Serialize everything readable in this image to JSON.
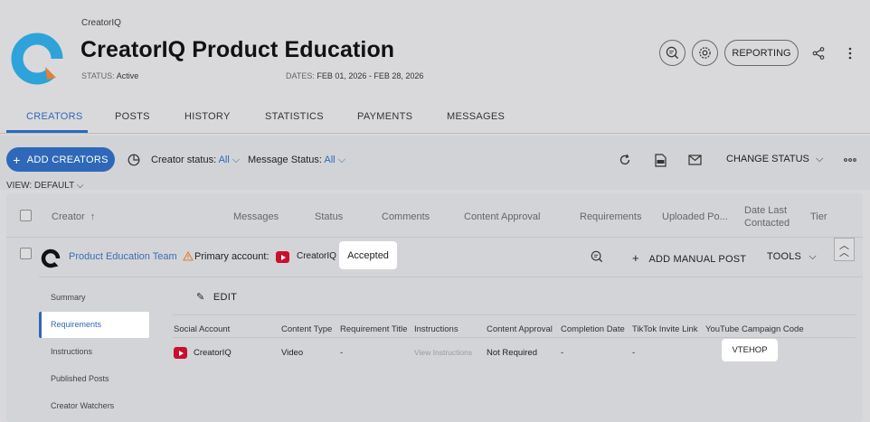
{
  "header": {
    "breadcrumb": "CreatorIQ",
    "title": "CreatorIQ Product Education",
    "status_label": "STATUS:",
    "status_value": "Active",
    "dates_label": "DATES:",
    "dates_value": "FEB 01, 2026 - FEB 28, 2026",
    "reporting_label": "REPORTING"
  },
  "tabs": [
    "CREATORS",
    "POSTS",
    "HISTORY",
    "STATISTICS",
    "PAYMENTS",
    "MESSAGES"
  ],
  "toolbar": {
    "add_creators": "ADD CREATORS",
    "creator_status_label": "Creator status:",
    "creator_status_value": "All",
    "message_status_label": "Message Status:",
    "message_status_value": "All",
    "change_status": "CHANGE STATUS",
    "view_default": "VIEW: DEFAULT"
  },
  "table": {
    "headers": {
      "creator": "Creator",
      "messages": "Messages",
      "status": "Status",
      "comments": "Comments",
      "content_approval": "Content Approval",
      "requirements": "Requirements",
      "uploaded": "Uploaded Po...",
      "date_last_1": "Date Last",
      "date_last_2": "Contacted",
      "tier": "Tier"
    },
    "row": {
      "team": "Product Education Team",
      "primary_label": "Primary account:",
      "primary_account": "CreatorIQ",
      "status_badge": "Accepted",
      "add_manual_post": "ADD MANUAL POST",
      "tools": "TOOLS"
    }
  },
  "subnav": {
    "items": [
      "Summary",
      "Requirements",
      "Instructions",
      "Published Posts",
      "Creator Watchers"
    ],
    "edit": "EDIT"
  },
  "requirements_table": {
    "headers": [
      "Social Account",
      "Content Type",
      "Requirement Title",
      "Instructions",
      "Content Approval",
      "Completion Date",
      "TikTok Invite Link",
      "YouTube Campaign Code"
    ],
    "row": {
      "account": "CreatorIQ",
      "content_type": "Video",
      "requirement_title": "-",
      "instructions": "View Instructions",
      "content_approval": "Not Required",
      "completion_date": "-",
      "tiktok": "-",
      "campaign_code": "VTEHOP"
    }
  },
  "colors": {
    "accent": "#2f68b8",
    "youtube": "#c8102e",
    "warning": "#e0803a"
  }
}
